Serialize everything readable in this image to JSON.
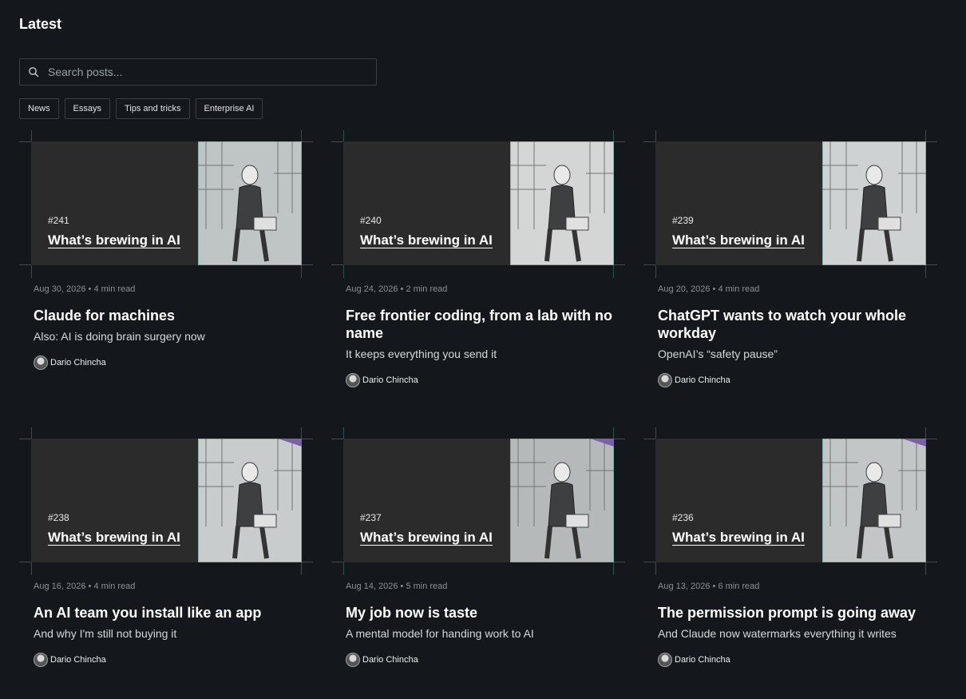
{
  "page": {
    "title": "Latest"
  },
  "search": {
    "placeholder": "Search posts..."
  },
  "filters": [
    "News",
    "Essays",
    "Tips and tricks",
    "Enterprise AI"
  ],
  "posts": [
    {
      "number": "#241",
      "hero_title": "What’s brewing in AI",
      "date": "Aug 30, 2026",
      "read": "4 min read",
      "title": "Claude for machines",
      "subtitle": "Also: AI is doing brain surgery now",
      "author": "Dario Chincha",
      "art": "man-at-cafe-laptop-illustration"
    },
    {
      "number": "#240",
      "hero_title": "What’s brewing in AI",
      "date": "Aug 24, 2026",
      "read": "2 min read",
      "title": "Free frontier coding, from a lab with no name",
      "subtitle": "It keeps everything you send it",
      "author": "Dario Chincha",
      "art": "man-holding-mug-by-window-illustration"
    },
    {
      "number": "#239",
      "hero_title": "What’s brewing in AI",
      "date": "Aug 20, 2026",
      "read": "4 min read",
      "title": "ChatGPT wants to watch your whole workday",
      "subtitle": "OpenAI’s “safety pause”",
      "author": "Dario Chincha",
      "art": "man-on-floor-laptop-illustration"
    },
    {
      "number": "#238",
      "hero_title": "What’s brewing in AI",
      "date": "Aug 16, 2026",
      "read": "4 min read",
      "title": "An AI team you install like an app",
      "subtitle": "And why I'm still not buying it",
      "author": "Dario Chincha",
      "art": "man-arms-crossed-illustration"
    },
    {
      "number": "#237",
      "hero_title": "What’s brewing in AI",
      "date": "Aug 14, 2026",
      "read": "5 min read",
      "title": "My job now is taste",
      "subtitle": "A mental model for handing work to AI",
      "author": "Dario Chincha",
      "art": "man-at-train-table-illustration"
    },
    {
      "number": "#236",
      "hero_title": "What’s brewing in AI",
      "date": "Aug 13, 2026",
      "read": "6 min read",
      "title": "The permission prompt is going away",
      "subtitle": "And Claude now watermarks everything it writes",
      "author": "Dario Chincha",
      "art": "man-drinking-on-train-illustration"
    }
  ],
  "colors": {
    "background": "#14171b",
    "hero_bg": "#2c2b2b",
    "frame_line": "#2e5350"
  }
}
